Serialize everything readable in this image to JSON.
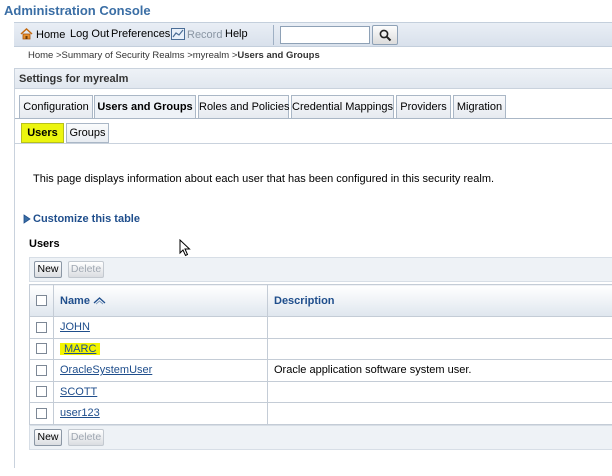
{
  "app": {
    "title": "Administration Console"
  },
  "toolbar": {
    "home": "Home",
    "logout": "Log Out",
    "preferences": "Preferences",
    "record": "Record",
    "help": "Help",
    "search_value": ""
  },
  "breadcrumb": {
    "items": [
      "Home",
      "Summary of Security Realms",
      "myrealm"
    ],
    "current": "Users and Groups"
  },
  "settings": {
    "title": "Settings for myrealm"
  },
  "tabs": [
    "Configuration",
    "Users and Groups",
    "Roles and Policies",
    "Credential Mappings",
    "Providers",
    "Migration"
  ],
  "subtabs": [
    "Users",
    "Groups"
  ],
  "content": {
    "description": "This page displays information about each user that has been configured in this security realm.",
    "customize": "Customize this table",
    "table_caption": "Users"
  },
  "buttons": {
    "new": "New",
    "delete": "Delete"
  },
  "table": {
    "headers": {
      "name": "Name",
      "description": "Description"
    },
    "rows": [
      {
        "name": "JOHN",
        "description": ""
      },
      {
        "name": "MARC",
        "description": ""
      },
      {
        "name": "OracleSystemUser",
        "description": "Oracle application software system user."
      },
      {
        "name": "SCOTT",
        "description": ""
      },
      {
        "name": "user123",
        "description": ""
      }
    ]
  },
  "colors": {
    "accent": "#1f4e8c",
    "highlight": "#f2f400",
    "title": "#3a6ea5"
  }
}
